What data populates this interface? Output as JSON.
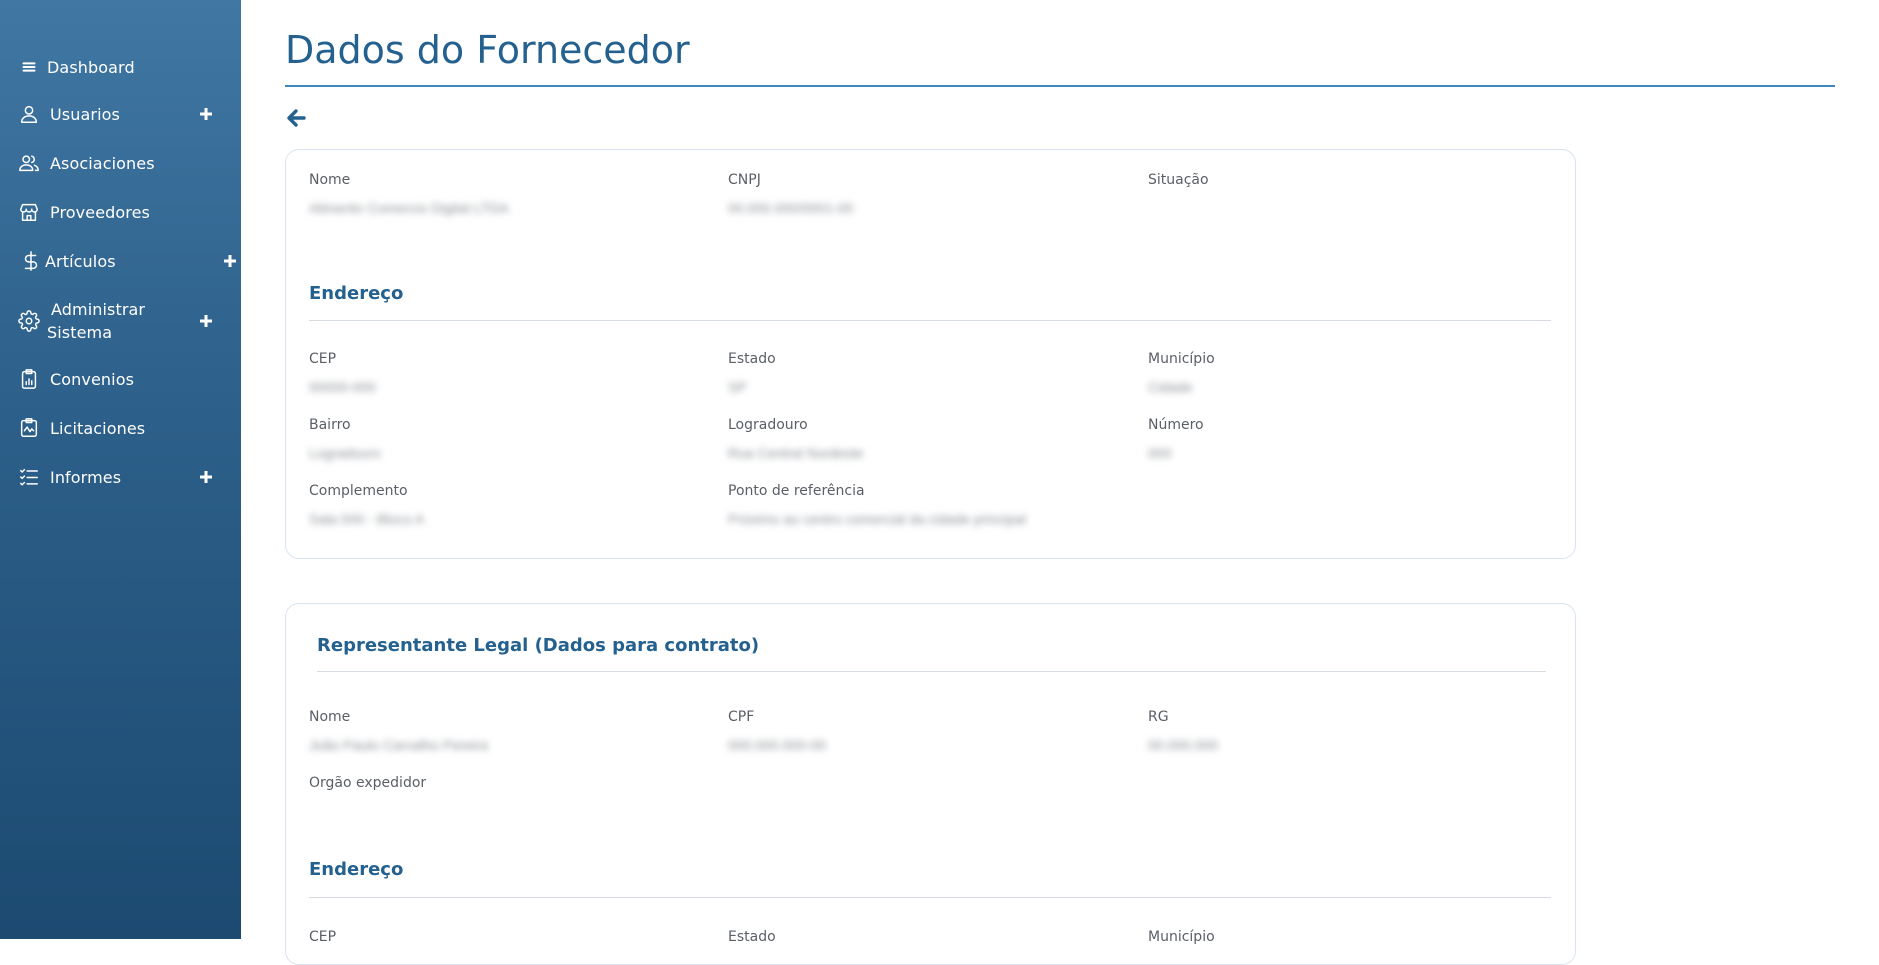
{
  "sidebar": {
    "items": [
      {
        "label": "Dashboard",
        "icon": "menu-icon",
        "has_plus": false
      },
      {
        "label": "Usuarios",
        "icon": "user-icon",
        "has_plus": true
      },
      {
        "label": "Asociaciones",
        "icon": "users-icon",
        "has_plus": false
      },
      {
        "label": "Proveedores",
        "icon": "store-icon",
        "has_plus": false
      },
      {
        "label": "Artículos",
        "icon": "dollar-icon",
        "has_plus": true
      },
      {
        "label_line1": "Administrar",
        "label_line2": "Sistema",
        "icon": "gear-icon",
        "has_plus": true
      },
      {
        "label": "Convenios",
        "icon": "clipboard-chart-icon",
        "has_plus": false
      },
      {
        "label": "Licitaciones",
        "icon": "chart-pulse-icon",
        "has_plus": false
      },
      {
        "label": "Informes",
        "icon": "checklist-icon",
        "has_plus": true
      }
    ]
  },
  "page": {
    "title": "Dados do Fornecedor"
  },
  "supplier": {
    "nome_label": "Nome",
    "nome_value": "Alimento Comercio Digital LTDA",
    "cnpj_label": "CNPJ",
    "cnpj_value": "00.000.000/0001-00",
    "situacao_label": "Situação",
    "address_title": "Endereço",
    "cep_label": "CEP",
    "cep_value": "00000-000",
    "estado_label": "Estado",
    "estado_value": "SP",
    "municipio_label": "Município",
    "municipio_value": "Cidade",
    "bairro_label": "Bairro",
    "bairro_value": "Logradouro",
    "logradouro_label": "Logradouro",
    "logradouro_value": "Rua Central Nordeste",
    "numero_label": "Número",
    "numero_value": "000",
    "complemento_label": "Complemento",
    "complemento_value": "Sala 000 - Bloco A",
    "referencia_label": "Ponto de referência",
    "referencia_value": "Próximo ao centro comercial da cidade principal"
  },
  "representative": {
    "title": "Representante Legal (Dados para contrato)",
    "nome_label": "Nome",
    "nome_value": "João Paulo Carvalho Pereira",
    "cpf_label": "CPF",
    "cpf_value": "000.000.000-00",
    "rg_label": "RG",
    "rg_value": "00.000.000",
    "orgao_label": "Orgão expedidor",
    "address_title": "Endereço",
    "cep_label": "CEP",
    "estado_label": "Estado",
    "municipio_label": "Município"
  },
  "colors": {
    "accent": "#24618f",
    "sidebar_top": "#4077a3",
    "sidebar_bottom": "#1c4a71"
  }
}
